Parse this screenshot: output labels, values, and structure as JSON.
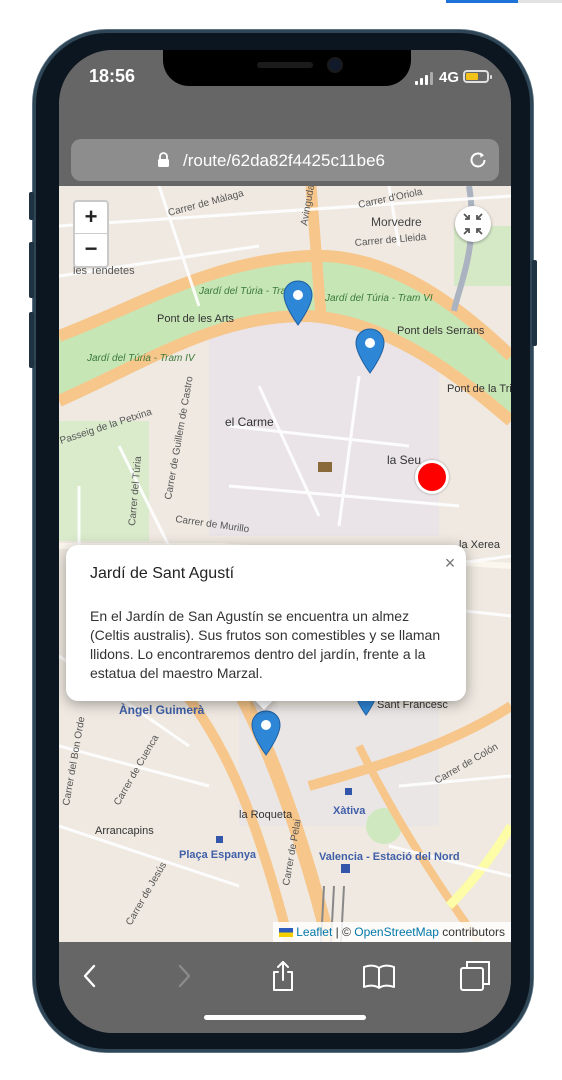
{
  "status_bar": {
    "time": "18:56",
    "network": "4G"
  },
  "browser": {
    "url": "/route/62da82f4425c11be6"
  },
  "map": {
    "zoom_in_label": "+",
    "zoom_out_label": "−",
    "street_labels": [
      "Carrer de Màlaga",
      "Avinguda",
      "Carrer d'Oriola",
      "Morvedre",
      "Carrer de Lleida",
      "les Tendetes",
      "Jardí del Túria - Tram V",
      "Jardí del Túria - Tram VI",
      "Pont de les Arts",
      "Pont dels Serrans",
      "Jardí del Túria - Tram IV",
      "Pont de la Trinitat",
      "Passeig de la Petxina",
      "Carrer de Guillem de Castro",
      "el Carme",
      "la Seu",
      "Carrer del Túria",
      "Carrer de Murillo",
      "la Xerea",
      "Àngel Guimerà",
      "Carrer del Bon Orde",
      "Carrer de Cuenca",
      "Arrancapins",
      "la Roqueta",
      "Xàtiva",
      "Plaça Espanya",
      "Carrer de Jesús",
      "Valencia - Estació del Nord",
      "Carrer de Colón",
      "Carrer de Pelai",
      "Sant Francesc"
    ]
  },
  "popup": {
    "title": "Jardí de Sant Agustí",
    "text": "En el Jardín de San Agustín se encuentra un almez (Celtis australis). Sus frutos son comestibles y se llaman llidons. Lo encontraremos dentro del jardín, frente a la estatua del maestro Marzal.",
    "close_label": "×"
  },
  "attribution": {
    "leaflet": "Leaflet",
    "separator": " | © ",
    "osm": "OpenStreetMap",
    "contributors": " contributors"
  },
  "colors": {
    "marker_blue": "#2e86d6",
    "current_location": "#ff0000",
    "park_green": "#c7e6b5",
    "major_road": "#f7c68a",
    "link_blue": "#0078a8"
  },
  "toolbar": {
    "icons": [
      "back-icon",
      "forward-icon",
      "share-icon",
      "bookmarks-icon",
      "tabs-icon"
    ]
  }
}
